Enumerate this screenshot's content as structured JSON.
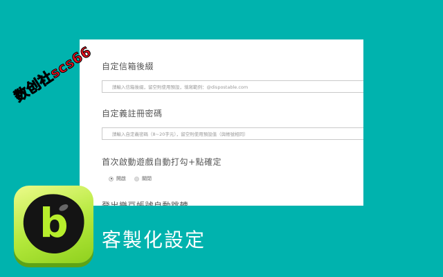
{
  "settings": {
    "email_suffix": {
      "title": "自定信箱後綴",
      "placeholder": "請輸入信箱後綴，留空則使用預設，填寫範例：@dispostable.com"
    },
    "register_password": {
      "title": "自定義註冊密碼",
      "placeholder": "請輸入自定義密碼（8~20字元），留空則使用預設值（與帳號相同）"
    },
    "auto_check": {
      "title": "首次啟動遊戲自動打勾+點確定",
      "options": [
        "開啟",
        "關閉"
      ],
      "selected": "開啟"
    },
    "next_section": {
      "title": "登出樂豆帳號自動跳轉"
    }
  },
  "watermark": "数创社scs66",
  "logo": {
    "letter": "b"
  },
  "caption": "客製化設定",
  "colors": {
    "background": "#00b3ae",
    "watermark": "#e8121f",
    "logo_green": "#b3e83b"
  }
}
